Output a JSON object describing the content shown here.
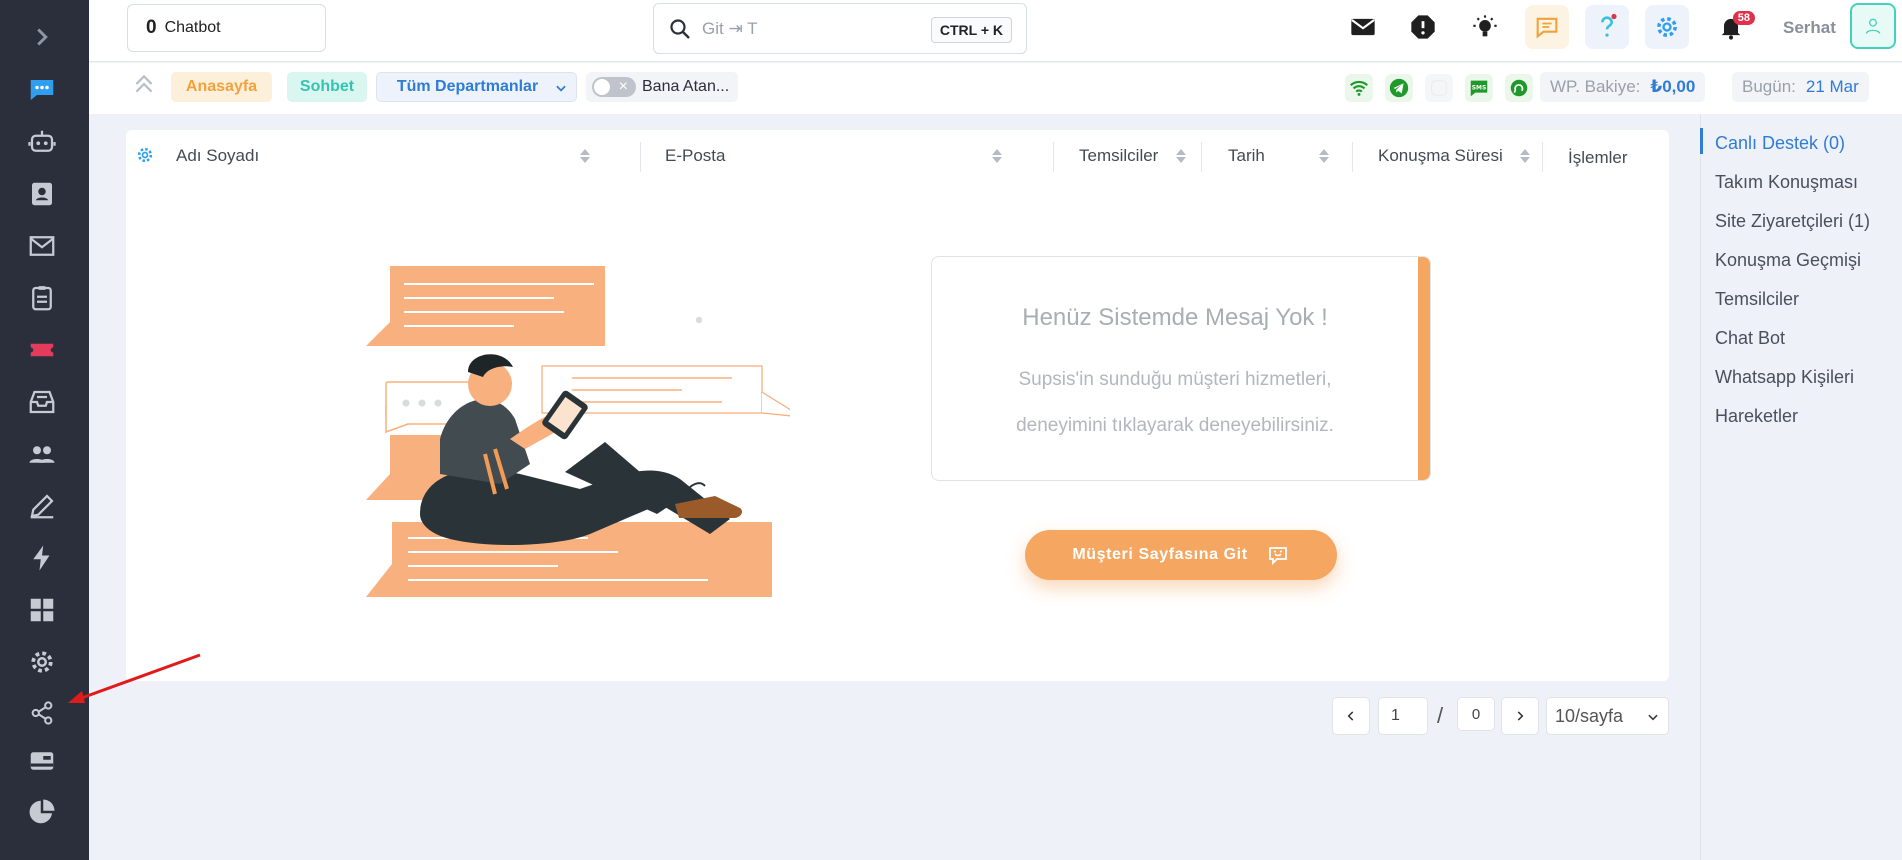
{
  "topbar": {
    "chatbot_count": "0",
    "chatbot_label": "Chatbot",
    "search_text": "Git ⇥ T",
    "search_shortcut": "CTRL + K",
    "notification_count": "58",
    "username": "Serhat"
  },
  "subbar": {
    "home_label": "Anasayfa",
    "chat_label": "Sohbet",
    "department_select": "Tüm Departmanlar",
    "assigned_toggle_label": "Bana Atan...",
    "wp_balance_label": "WP. Bakiye:",
    "wp_balance_value": "₺0,00",
    "today_label": "Bugün:",
    "today_value": "21 Mar"
  },
  "table": {
    "columns": [
      "Adı Soyadı",
      "E-Posta",
      "Temsilciler",
      "Tarih",
      "Konuşma Süresi",
      "İşlemler"
    ]
  },
  "empty_state": {
    "title": "Henüz Sistemde Mesaj Yok !",
    "line1": "Supsis'in sunduğu müşteri hizmetleri,",
    "line2": "deneyimini tıklayarak deneyebilirsiniz.",
    "cta_label": "Müşteri Sayfasına Git"
  },
  "pagination": {
    "current_page": "1",
    "separator": "/",
    "total_pages": "0",
    "page_size": "10/sayfa"
  },
  "right_panel": {
    "items": [
      {
        "label": "Canlı Destek (0)"
      },
      {
        "label": "Takım Konuşması"
      },
      {
        "label": "Site Ziyaretçileri (1)"
      },
      {
        "label": "Konuşma Geçmişi"
      },
      {
        "label": "Temsilciler"
      },
      {
        "label": "Chat Bot"
      },
      {
        "label": "Whatsapp Kişileri"
      },
      {
        "label": "Hareketler"
      }
    ]
  },
  "sidebar": {
    "icons": [
      "expand-icon",
      "live-chat-icon",
      "chatbot-icon",
      "contacts-icon",
      "mail-icon",
      "clipboard-icon",
      "ticket-icon",
      "inbox-tray-icon",
      "team-icon",
      "edit-icon",
      "lightning-icon",
      "dashboard-grid-icon",
      "settings-gear-icon",
      "share-icon",
      "card-icon",
      "pie-chart-icon"
    ]
  },
  "colors": {
    "sidebar_bg": "#2b2f3c",
    "accent_blue": "#2f7cd6",
    "accent_orange": "#f5a661",
    "accent_teal": "#37c2b1",
    "annotation_red": "#e01b1b"
  }
}
